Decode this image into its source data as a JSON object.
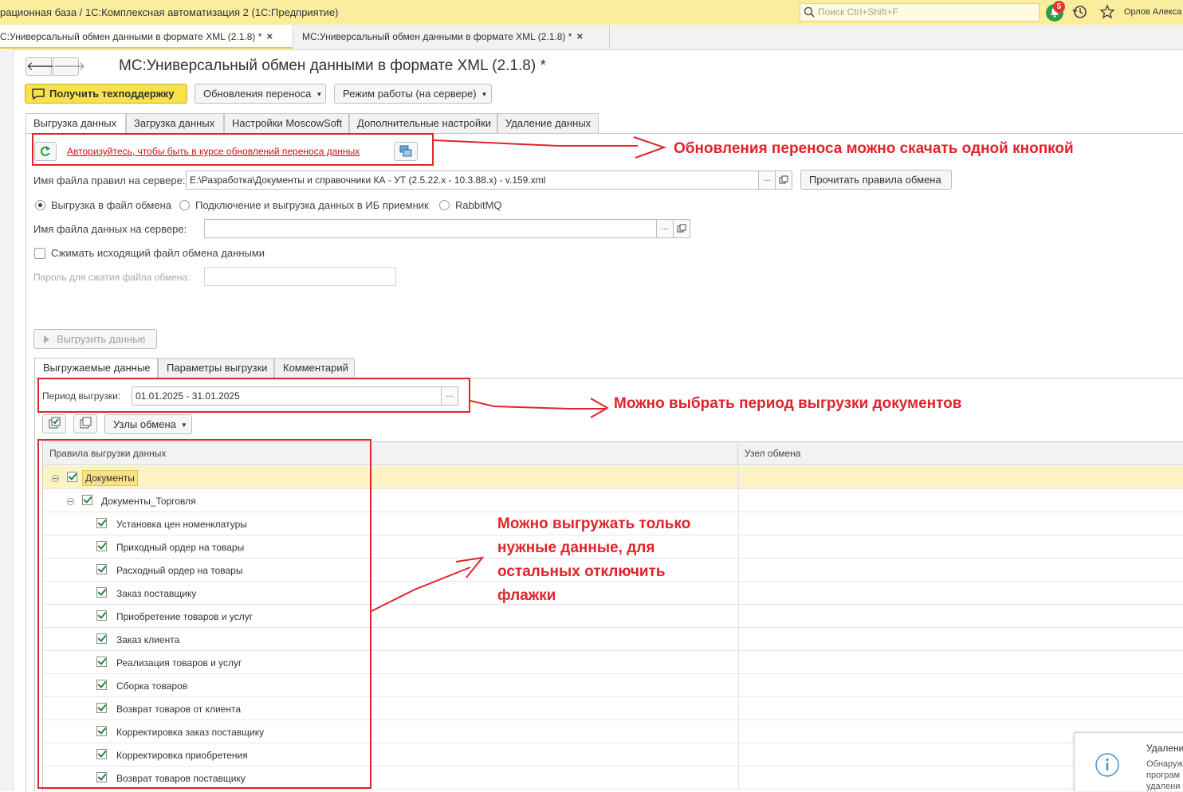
{
  "window": {
    "title": "рационная база / 1С:Комплексная автоматизация 2  (1С:Предприятие)",
    "search_placeholder": "Поиск Ctrl+Shift+F",
    "notifications_count": "5",
    "user": "Орлов Алекса"
  },
  "tabs": [
    {
      "label": "С:Универсальный обмен данными в формате XML (2.1.8) *",
      "close": "×"
    },
    {
      "label": "МС:Универсальный обмен данными в формате XML (2.1.8) *",
      "close": "×"
    }
  ],
  "form": {
    "title": "МС:Универсальный обмен данными в формате XML (2.1.8) *",
    "nav_back": "🡐",
    "nav_fwd": "🡒"
  },
  "toolbar": {
    "support": "Получить техподдержку",
    "updates": "Обновления переноса",
    "mode": "Режим работы (на сервере)"
  },
  "main_tabs": [
    "Выгрузка данных",
    "Загрузка данных",
    "Настройки MoscowSoft",
    "Дополнительные настройки",
    "Удаление данных"
  ],
  "update_link": "Авторизуйтесь, чтобы быть в курсе обновлений переноса данных",
  "rules": {
    "label": "Имя файла правил на сервере:",
    "value": "E:\\Разработка\\Документы и справочники КА - УТ (2.5.22.x - 10.3.88.x) - v.159.xml",
    "select": "...",
    "read_button": "Прочитать правила обмена"
  },
  "mode_options": {
    "file": "Выгрузка в файл обмена",
    "connect": "Подключение и выгрузка данных в ИБ приемник",
    "rabbit": "RabbitMQ",
    "selected": "file"
  },
  "data_file": {
    "label": "Имя файла данных на сервере:",
    "value": "",
    "select": "..."
  },
  "compress": {
    "label": "Сжимать исходящий файл обмена данными",
    "checked": false
  },
  "password": {
    "label": "Пароль для сжатия файла обмена:",
    "value": ""
  },
  "export_button": "Выгрузить данные",
  "sub_tabs": [
    "Выгружаемые данные",
    "Параметры выгрузки",
    "Комментарий"
  ],
  "period": {
    "label": "Период выгрузки:",
    "value": "01.01.2025 - 31.01.2025",
    "select": "..."
  },
  "nodes_button": "Узлы обмена",
  "table": {
    "columns": [
      "Правила выгрузки данных",
      "Узел обмена"
    ],
    "root": "Документы",
    "group": "Документы_Торговля",
    "items": [
      "Установка цен номенклатуры",
      "Приходный ордер на товары",
      "Расходный ордер на товары",
      "Заказ поставщику",
      "Приобретение товаров и услуг",
      "Заказ клиента",
      "Реализация товаров и услуг",
      "Сборка товаров",
      "Возврат товаров от клиента",
      "Корректировка заказ поставщику",
      "Корректировка приобретения",
      "Возврат товаров поставщику"
    ]
  },
  "annotations": {
    "updates": "Обновления переноса можно скачать одной кнопкой",
    "period": "Можно выбрать период выгрузки документов",
    "flags_lines": [
      "Можно выгружать только",
      "нужные данные, для",
      "остальных отключить",
      "флажки"
    ]
  },
  "notification": {
    "title": "Удалени",
    "body_lines": [
      "Обнаруж",
      "програм",
      "удалени"
    ]
  },
  "colors": {
    "title_bar": "#fbed9e",
    "accent_button": "#f7e24a",
    "annotation_red": "#e0242b",
    "check_green": "#1e8a3a",
    "selected_row": "#fbf3c4"
  }
}
